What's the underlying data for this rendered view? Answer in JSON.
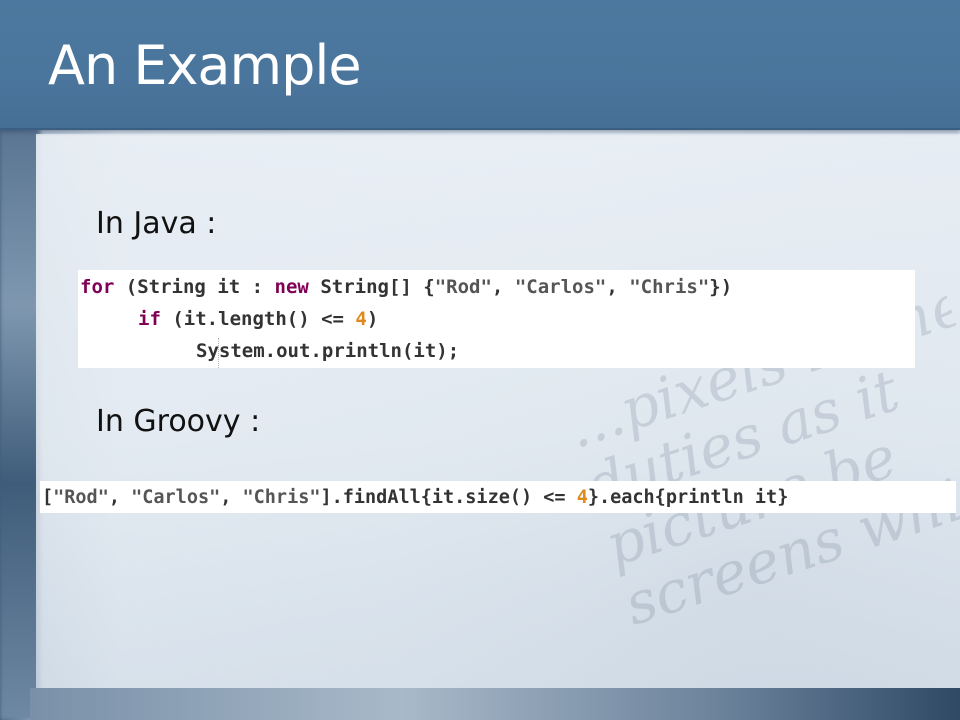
{
  "slide": {
    "title": "An Example",
    "watermark_lines": [
      "...pixels in the",
      "duties as it",
      "picture be",
      "screens whi"
    ]
  },
  "java": {
    "label": "In Java :",
    "code_lines": [
      "for (String it : new String[] {\"Rod\", \"Carlos\", \"Chris\"})",
      "if (it.length() <= 4)",
      "System.out.println(it);"
    ]
  },
  "groovy": {
    "label": "In Groovy :",
    "code_lines": [
      "[\"Rod\", \"Carlos\", \"Chris\"].findAll{it.size() <= 4}.each{println it}"
    ]
  },
  "colors": {
    "title_bar": "#4a759c",
    "keyword": "#7f0055",
    "number": "#e08a1e",
    "code_text": "#333333"
  }
}
